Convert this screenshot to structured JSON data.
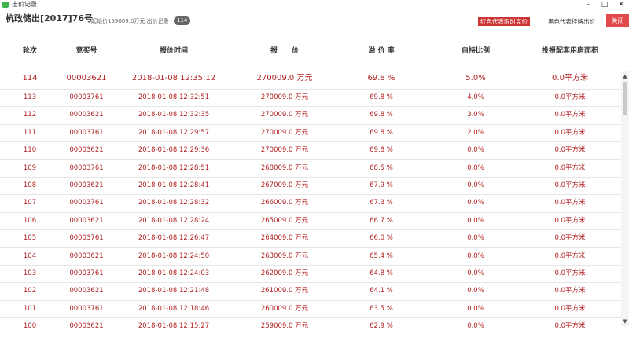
{
  "window": {
    "title": "出价记录",
    "controls": {
      "minimize": "–",
      "maximize": "□",
      "close": "✕"
    }
  },
  "header": {
    "title": "杭政储出[2017]76号",
    "start_price": "起始价159009.0万元 出价记录",
    "bid_count": "114",
    "legend_red": "红色代表限时竞价",
    "legend_black": "黑色代表挂牌出价",
    "close_label": "关闭"
  },
  "table": {
    "columns": [
      "轮次",
      "竞买号",
      "报价时间",
      "报　　价",
      "溢 价 率",
      "自持比例",
      "投报配套用房面积"
    ],
    "rows": [
      {
        "round": "114",
        "bidder": "00003621",
        "time": "2018-01-08 12:35:12",
        "price": "270009.0 万元",
        "premium": "69.8 %",
        "self_hold": "5.0%",
        "area": "0.0平方米"
      },
      {
        "round": "113",
        "bidder": "00003761",
        "time": "2018-01-08 12:32:51",
        "price": "270009.0 万元",
        "premium": "69.8 %",
        "self_hold": "4.0%",
        "area": "0.0平方米"
      },
      {
        "round": "112",
        "bidder": "00003621",
        "time": "2018-01-08 12:32:35",
        "price": "270009.0 万元",
        "premium": "69.8 %",
        "self_hold": "3.0%",
        "area": "0.0平方米"
      },
      {
        "round": "111",
        "bidder": "00003761",
        "time": "2018-01-08 12:29:57",
        "price": "270009.0 万元",
        "premium": "69.8 %",
        "self_hold": "2.0%",
        "area": "0.0平方米"
      },
      {
        "round": "110",
        "bidder": "00003621",
        "time": "2018-01-08 12:29:36",
        "price": "270009.0 万元",
        "premium": "69.8 %",
        "self_hold": "0.0%",
        "area": "0.0平方米"
      },
      {
        "round": "109",
        "bidder": "00003761",
        "time": "2018-01-08 12:28:51",
        "price": "268009.0 万元",
        "premium": "68.5 %",
        "self_hold": "0.0%",
        "area": "0.0平方米"
      },
      {
        "round": "108",
        "bidder": "00003621",
        "time": "2018-01-08 12:28:41",
        "price": "267009.0 万元",
        "premium": "67.9 %",
        "self_hold": "0.0%",
        "area": "0.0平方米"
      },
      {
        "round": "107",
        "bidder": "00003761",
        "time": "2018-01-08 12:28:32",
        "price": "266009.0 万元",
        "premium": "67.3 %",
        "self_hold": "0.0%",
        "area": "0.0平方米"
      },
      {
        "round": "106",
        "bidder": "00003621",
        "time": "2018-01-08 12:28:24",
        "price": "265009.0 万元",
        "premium": "66.7 %",
        "self_hold": "0.0%",
        "area": "0.0平方米"
      },
      {
        "round": "105",
        "bidder": "00003761",
        "time": "2018-01-08 12:26:47",
        "price": "264009.0 万元",
        "premium": "66.0 %",
        "self_hold": "0.0%",
        "area": "0.0平方米"
      },
      {
        "round": "104",
        "bidder": "00003621",
        "time": "2018-01-08 12:24:50",
        "price": "263009.0 万元",
        "premium": "65.4 %",
        "self_hold": "0.0%",
        "area": "0.0平方米"
      },
      {
        "round": "103",
        "bidder": "00003761",
        "time": "2018-01-08 12:24:03",
        "price": "262009.0 万元",
        "premium": "64.8 %",
        "self_hold": "0.0%",
        "area": "0.0平方米"
      },
      {
        "round": "102",
        "bidder": "00003621",
        "time": "2018-01-08 12:21:48",
        "price": "261009.0 万元",
        "premium": "64.1 %",
        "self_hold": "0.0%",
        "area": "0.0平方米"
      },
      {
        "round": "101",
        "bidder": "00003761",
        "time": "2018-01-08 12:18:46",
        "price": "260009.0 万元",
        "premium": "63.5 %",
        "self_hold": "0.0%",
        "area": "0.0平方米"
      },
      {
        "round": "100",
        "bidder": "00003621",
        "time": "2018-01-08 12:15:27",
        "price": "259009.0 万元",
        "premium": "62.9 %",
        "self_hold": "0.0%",
        "area": "0.0平方米"
      }
    ]
  },
  "colors": {
    "bid_text": "#b22222",
    "close_button": "#e14b4b",
    "legend_red": "#cc3333"
  },
  "icons": {
    "app": "app-icon",
    "scroll_up": "▲",
    "scroll_down": "▼"
  }
}
